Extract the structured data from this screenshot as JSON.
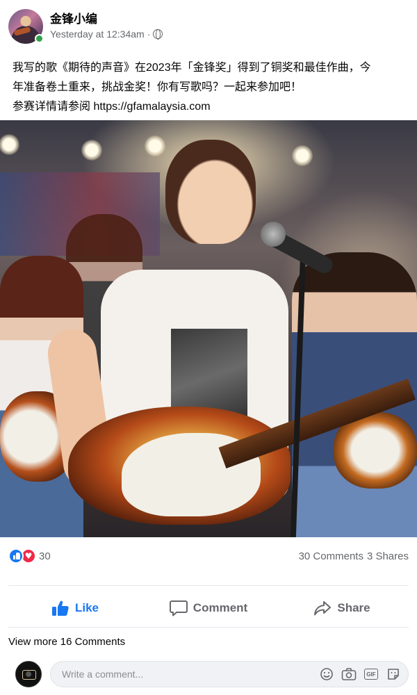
{
  "post": {
    "author": "金锋小编",
    "timestamp": "Yesterday at 12:34am",
    "separator": "·",
    "privacy_icon": "globe-icon",
    "text_line1": "我写的歌《期待的声音》在2023年「金锋奖」得到了铜奖和最佳作曲，今",
    "text_line2": "年准备卷土重来，挑战金奖！你有写歌吗？一起来参加吧！",
    "text_line3": "参赛详情请参阅 https://gfamalaysia.com"
  },
  "stats": {
    "reaction_icons": [
      "like-reaction",
      "love-reaction"
    ],
    "reaction_count": "30",
    "comments": "30 Comments",
    "shares": "3 Shares"
  },
  "actions": {
    "like": "Like",
    "comment": "Comment",
    "share": "Share"
  },
  "comments_section": {
    "view_more": "View more 16 Comments",
    "placeholder": "Write a comment...",
    "tools": [
      "emoji-icon",
      "camera-icon",
      "gif-icon",
      "sticker-icon"
    ]
  },
  "colors": {
    "accent": "#1877f2",
    "love": "#f02849",
    "online": "#31a24c",
    "muted_text": "#65676b"
  }
}
